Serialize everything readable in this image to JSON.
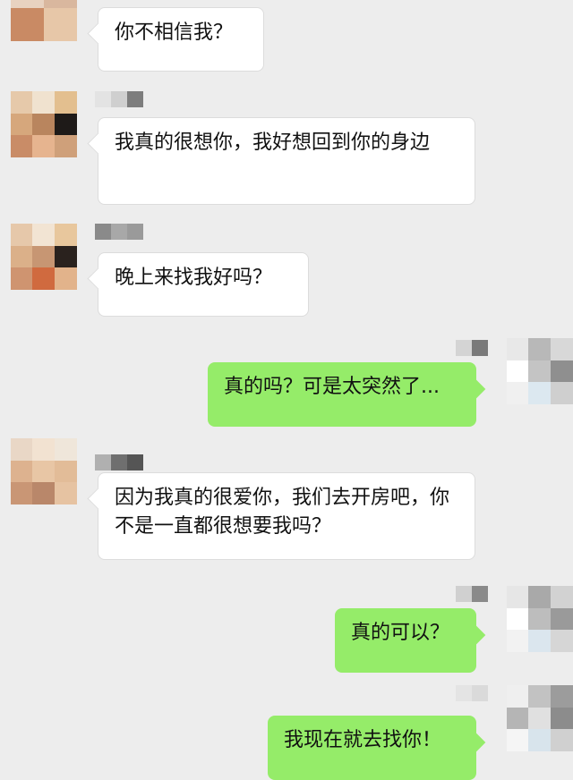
{
  "chat": {
    "messages": [
      {
        "side": "in",
        "text": "你不相信我？"
      },
      {
        "side": "in",
        "text": "我真的很想你，我好想回到你的身边"
      },
      {
        "side": "in",
        "text": "晚上来找我好吗？"
      },
      {
        "side": "out",
        "text": "真的吗？可是太突然了..."
      },
      {
        "side": "in",
        "text": "因为我真的很爱你，我们去开房吧，你不是一直都很想要我吗？"
      },
      {
        "side": "out",
        "text": "真的可以？"
      },
      {
        "side": "out",
        "text": "我现在就去找你！"
      }
    ]
  },
  "colors": {
    "incoming_bubble": "#ffffff",
    "outgoing_bubble": "#95ec69",
    "background": "#ededed"
  },
  "icons": {
    "avatar": "pixelated-avatar-icon",
    "sender_name": "pixelated-name-placeholder"
  }
}
